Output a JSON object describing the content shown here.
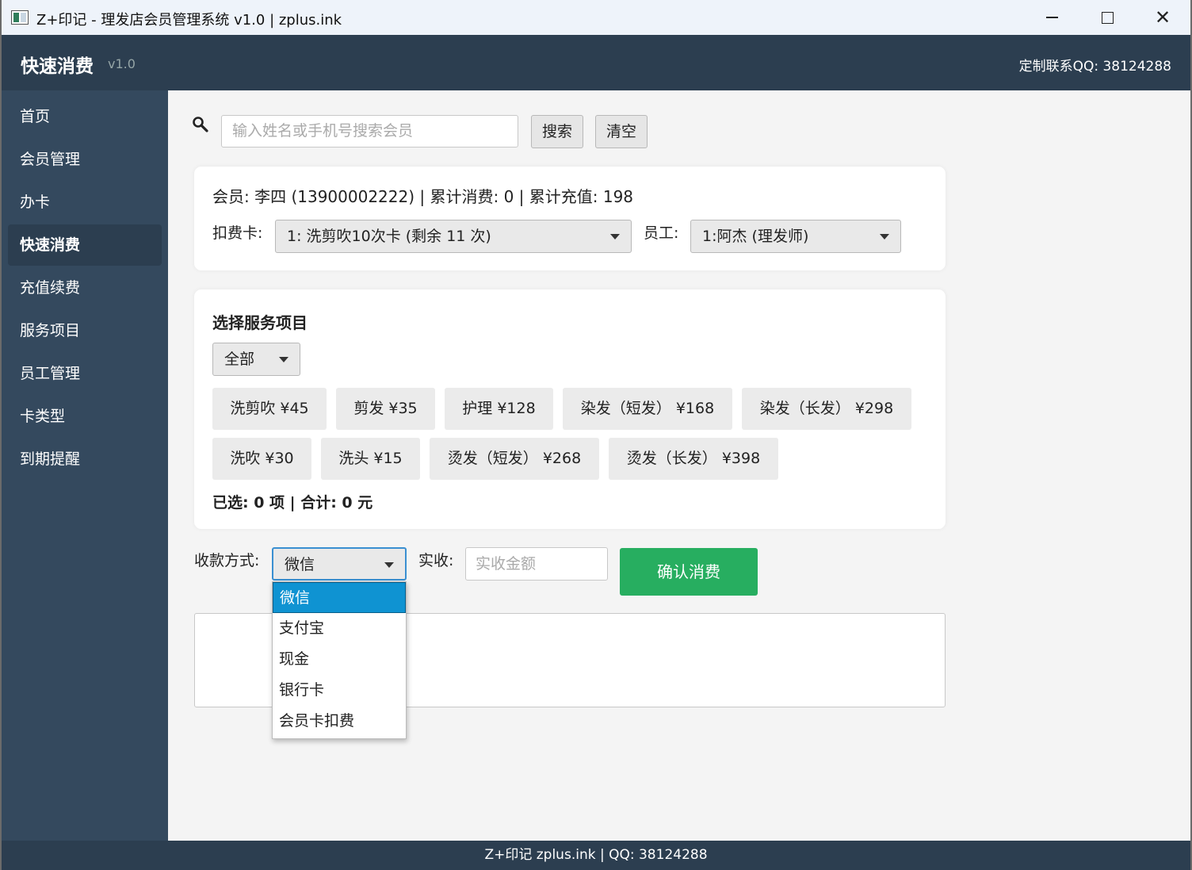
{
  "window": {
    "title": "Z+印记 - 理发店会员管理系统 v1.0 | zplus.ink",
    "minimize_glyph": "",
    "close_glyph": "✕"
  },
  "header": {
    "title": "快速消费",
    "version": "v1.0",
    "contact": "定制联系QQ: 38124288"
  },
  "sidebar": {
    "items": [
      {
        "label": "首页",
        "active": false
      },
      {
        "label": "会员管理",
        "active": false
      },
      {
        "label": "办卡",
        "active": false
      },
      {
        "label": "快速消费",
        "active": true
      },
      {
        "label": "充值续费",
        "active": false
      },
      {
        "label": "服务项目",
        "active": false
      },
      {
        "label": "员工管理",
        "active": false
      },
      {
        "label": "卡类型",
        "active": false
      },
      {
        "label": "到期提醒",
        "active": false
      }
    ]
  },
  "search": {
    "placeholder": "输入姓名或手机号搜索会员",
    "search_label": "搜索",
    "clear_label": "清空"
  },
  "member": {
    "info": "会员: 李四 (13900002222)  |  累计消费: 0  |  累计充值: 198",
    "card_label": "扣费卡:",
    "card_value": "1: 洗剪吹10次卡 (剩余 11 次)",
    "staff_label": "员工:",
    "staff_value": "1:阿杰 (理发师)"
  },
  "services": {
    "title": "选择服务项目",
    "category_value": "全部",
    "row1": [
      "洗剪吹 ¥45",
      "剪发 ¥35",
      "护理 ¥128",
      "染发（短发） ¥168",
      "染发（长发） ¥298"
    ],
    "row2": [
      "洗吹 ¥30",
      "洗头 ¥15",
      "烫发（短发） ¥268",
      "烫发（长发） ¥398"
    ],
    "summary": "已选: 0 项 | 合计: 0 元"
  },
  "payment": {
    "method_label": "收款方式:",
    "method_value": "微信",
    "amount_label": "实收:",
    "amount_placeholder": "实收金额",
    "confirm_label": "确认消费",
    "options": [
      "微信",
      "支付宝",
      "现金",
      "银行卡",
      "会员卡扣费"
    ],
    "selected_index": 0
  },
  "footer": {
    "text": "Z+印记 zplus.ink | QQ: 38124288"
  },
  "colors": {
    "header_bg": "#2c3e50",
    "sidebar_bg": "#34495e",
    "confirm_green": "#27ae60",
    "dropdown_highlight": "#0f93d2"
  }
}
